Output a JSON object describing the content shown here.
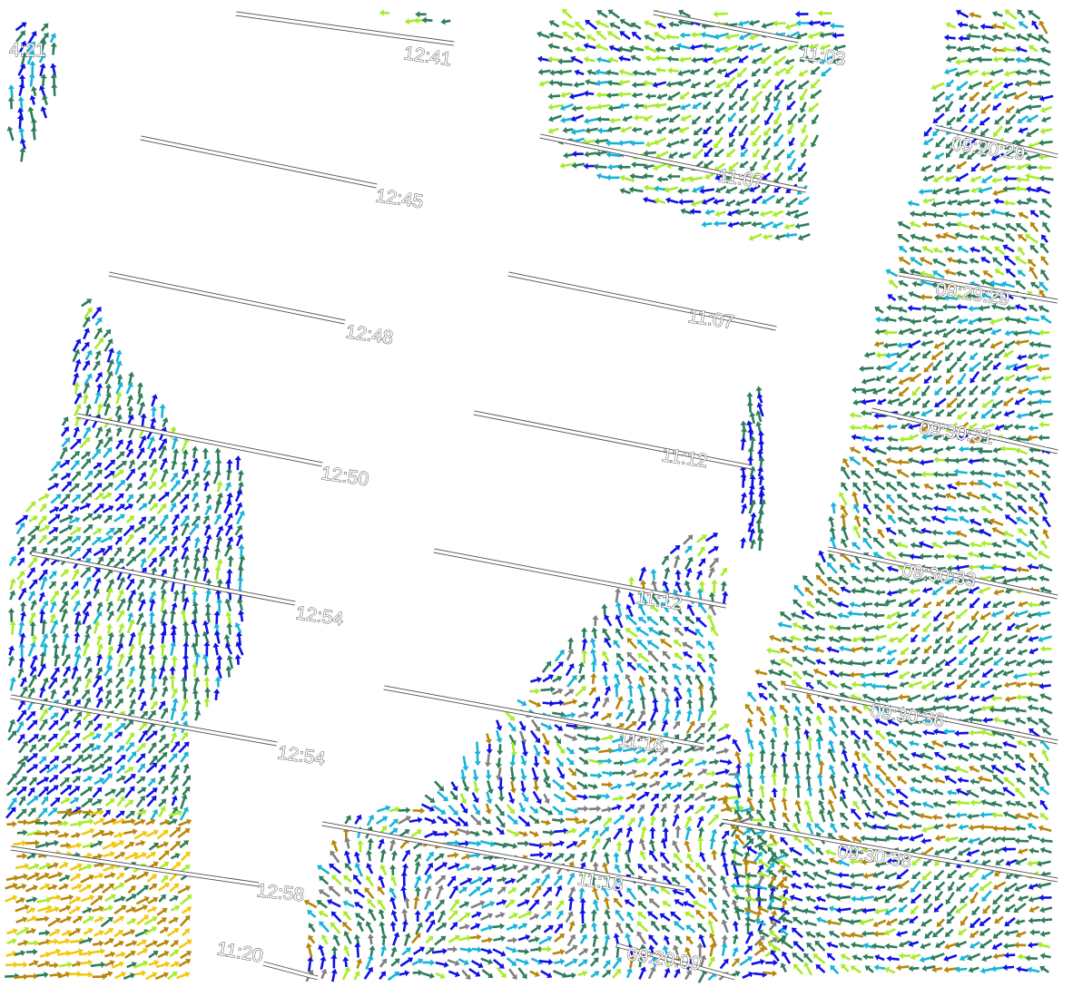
{
  "palette": {
    "blue": "#1010e6",
    "cyan": "#18b4d8",
    "dark_green": "#2e7d5b",
    "lime": "#a8ec2c",
    "bronze": "#b8860b",
    "yellow": "#f2c80f",
    "red": "#e63b1c",
    "gray": "#808080"
  },
  "tracks": [
    {
      "id": "t1241",
      "label": "12:41"
    },
    {
      "id": "t1245",
      "label": "12:45"
    },
    {
      "id": "t1248",
      "label": "12:48"
    },
    {
      "id": "t1250",
      "label": "12:50"
    },
    {
      "id": "t1254a",
      "label": "12:54"
    },
    {
      "id": "t1254b",
      "label": "12:54"
    },
    {
      "id": "t1258",
      "label": "12:58"
    },
    {
      "id": "t1120",
      "label": "11:20"
    },
    {
      "id": "t1103",
      "label": "11:03"
    },
    {
      "id": "t1107a",
      "label": "11:07"
    },
    {
      "id": "t1107b",
      "label": "11:07"
    },
    {
      "id": "t1112",
      "label": "11:12"
    },
    {
      "id": "t1112b",
      "label": "11:12"
    },
    {
      "id": "t1116",
      "label": "11:16"
    },
    {
      "id": "t1118",
      "label": "11:18"
    },
    {
      "id": "t0920a",
      "label": "09:20:29"
    },
    {
      "id": "t0929",
      "label": "09:29:29"
    },
    {
      "id": "t0931",
      "label": "09:30:31"
    },
    {
      "id": "t0933",
      "label": "09:30:33"
    },
    {
      "id": "t0936",
      "label": "09:30:36"
    },
    {
      "id": "t0938",
      "label": "09:30:38"
    },
    {
      "id": "t0920b",
      "label": "09:20:09"
    },
    {
      "id": "t0421",
      "label": "4:21"
    }
  ]
}
